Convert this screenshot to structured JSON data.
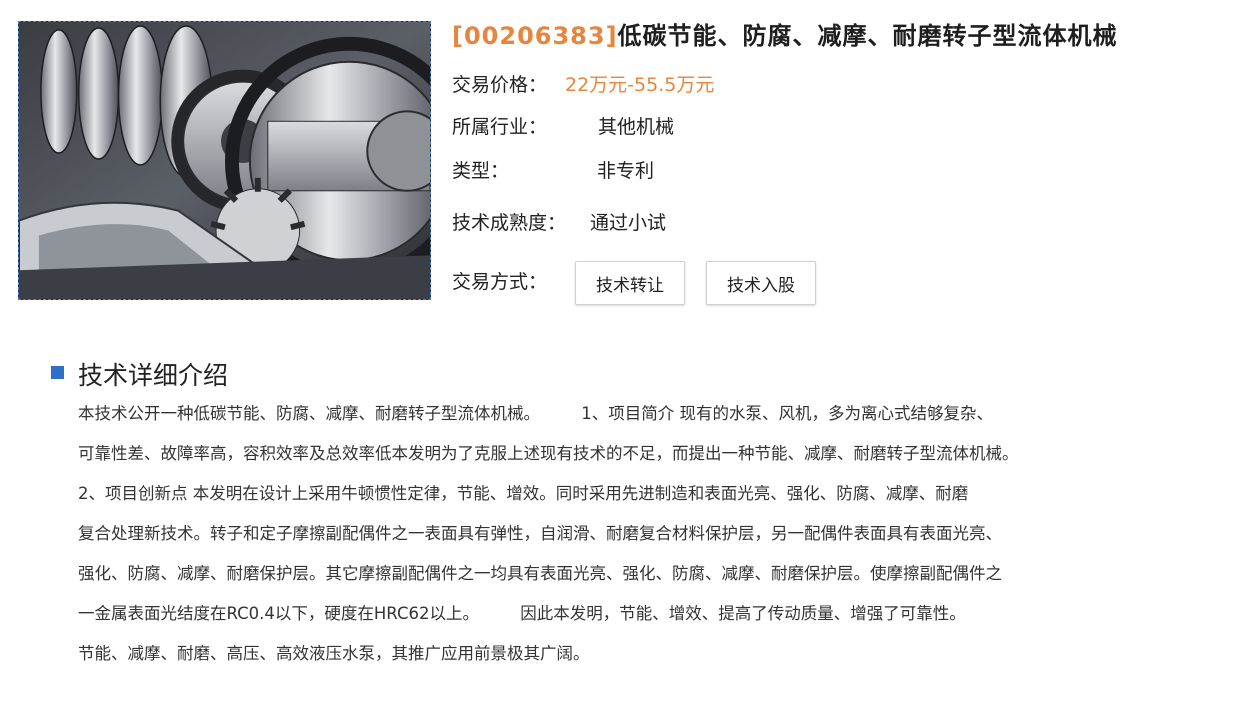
{
  "product": {
    "code": "[00206383]",
    "name": "低碳节能、防腐、减摩、耐磨转子型流体机械",
    "image_alt": "转子型流体机械剖视图"
  },
  "info": {
    "price_label": "交易价格：",
    "price_value": "22万元-55.5万元",
    "industry_label": "所属行业：",
    "industry_value": "其他机械",
    "type_label": "类型：",
    "type_value": "非专利",
    "maturity_label": "技术成熟度：",
    "maturity_value": "通过小试",
    "trade_label": "交易方式：",
    "trade_options": [
      "技术转让",
      "技术入股"
    ]
  },
  "detail": {
    "heading": "技术详细介绍",
    "lines": [
      "本技术公开一种低碳节能、防腐、减摩、耐磨转子型流体机械。　　　1、项目简介 现有的水泵、风机，多为离心式结够复杂、",
      "可靠性差、故障率高，容积效率及总效率低本发明为了克服上述现有技术的不足，而提出一种节能、减摩、耐磨转子型流体机械。",
      "2、项目创新点 本发明在设计上采用牛顿惯性定律，节能、增效。同时采用先进制造和表面光亮、强化、防腐、减摩、耐磨",
      "复合处理新技术。转子和定子摩擦副配偶件之一表面具有弹性，自润滑、耐磨复合材料保护层，另一配偶件表面具有表面光亮、",
      "强化、防腐、减摩、耐磨保护层。其它摩擦副配偶件之一均具有表面光亮、强化、防腐、减摩、耐磨保护层。使摩擦副配偶件之",
      "一金属表面光结度在RC0.4以下，硬度在HRC62以上。　　　因此本发明，节能、增效、提高了传动质量、增强了可靠性。",
      "节能、减摩、耐磨、高压、高效液压水泵，其推广应用前景极其广阔。"
    ]
  },
  "colors": {
    "accent": "#e8843c",
    "section_marker": "#2f6fc7",
    "image_border": "#4a7fd0"
  }
}
